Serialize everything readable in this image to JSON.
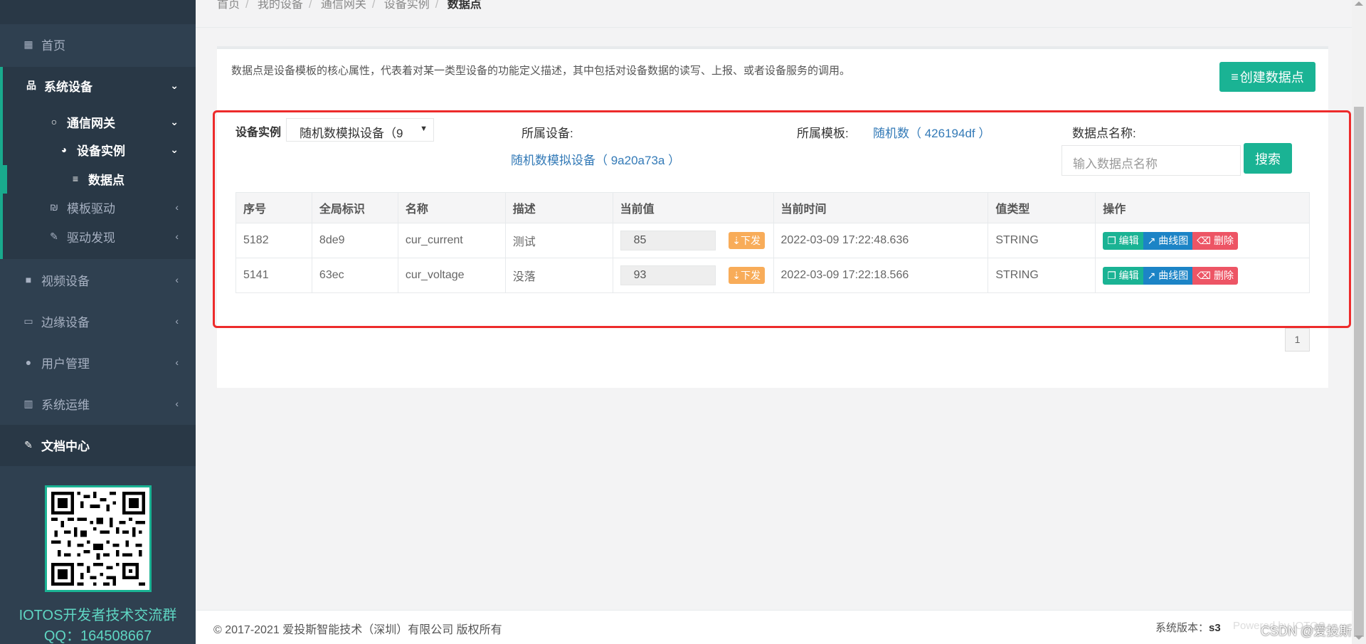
{
  "sidebar": {
    "items": [
      {
        "label": "首页",
        "icon": "grid-icon"
      },
      {
        "label": "系统设备",
        "icon": "sitemap-icon"
      },
      {
        "label": "通信网关",
        "icon": "circle-icon"
      },
      {
        "label": "设备实例",
        "icon": "dashboard-icon"
      },
      {
        "label": "数据点",
        "icon": "database-icon"
      },
      {
        "label": "模板驱动",
        "icon": "driver-icon"
      },
      {
        "label": "驱动发现",
        "icon": "plug-icon"
      },
      {
        "label": "视频设备",
        "icon": "video-icon"
      },
      {
        "label": "边缘设备",
        "icon": "laptop-icon"
      },
      {
        "label": "用户管理",
        "icon": "user-icon"
      },
      {
        "label": "系统运维",
        "icon": "bar-chart-icon"
      },
      {
        "label": "文档中心",
        "icon": "edit-icon"
      }
    ],
    "qr_title": "IOTOS开发者技术交流群",
    "qr_qq": "QQ：164508667"
  },
  "breadcrumb": [
    "首页",
    "我的设备",
    "通信网关",
    "设备实例",
    "数据点"
  ],
  "description": "数据点是设备模板的核心属性，代表着对某一类型设备的功能定义描述，其中包括对设备数据的读写、上报、或者设备服务的调用。",
  "create_button": "创建数据点",
  "filters": {
    "instance_label": "设备实例",
    "instance_value": "随机数模拟设备（9",
    "device_label": "所属设备:",
    "device_link": "随机数模拟设备（ 9a20a73a ）",
    "template_label": "所属模板:",
    "template_link": "随机数（ 426194df ）",
    "name_label": "数据点名称:",
    "name_placeholder": "输入数据点名称",
    "search_button": "搜索"
  },
  "table": {
    "columns": [
      "序号",
      "全局标识",
      "名称",
      "描述",
      "当前值",
      "当前时间",
      "值类型",
      "操作"
    ],
    "rows": [
      {
        "id": "5182",
        "uid": "8de9",
        "name": "cur_current",
        "desc": "测试",
        "value": "85",
        "time": "2022-03-09 17:22:48.636",
        "type": "STRING"
      },
      {
        "id": "5141",
        "uid": "63ec",
        "name": "cur_voltage",
        "desc": "没落",
        "value": "93",
        "time": "2022-03-09 17:22:18.566",
        "type": "STRING"
      }
    ],
    "push_label": "下发",
    "edit_label": "编辑",
    "curve_label": "曲线图",
    "delete_label": "删除"
  },
  "pagination": {
    "current": "1"
  },
  "footer": {
    "copyright": "© 2017-2021 爱投斯智能技术（深圳）有限公司 版权所有",
    "version_label": "系统版本：",
    "version_value": "s3",
    "powered": "Powered by IOTOS",
    "watermark": "CSDN @爱投斯"
  },
  "colors": {
    "accent": "#1ab394",
    "sidebar": "#2f4050",
    "link": "#337ab7",
    "warning": "#f8ac59",
    "danger": "#ed5565",
    "info": "#1c84c6",
    "highlight": "#ed2b2b"
  }
}
